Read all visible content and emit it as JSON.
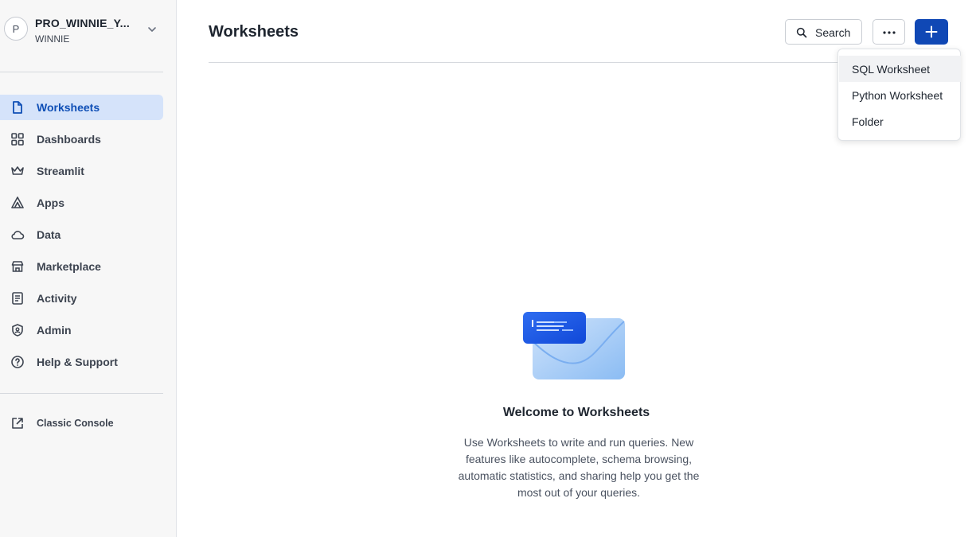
{
  "account": {
    "avatar_letter": "P",
    "name": "PRO_WINNIE_Y...",
    "user": "WINNIE"
  },
  "sidebar": {
    "items": [
      {
        "label": "Worksheets",
        "icon": "file-icon",
        "active": true
      },
      {
        "label": "Dashboards",
        "icon": "grid-icon",
        "active": false
      },
      {
        "label": "Streamlit",
        "icon": "crown-icon",
        "active": false
      },
      {
        "label": "Apps",
        "icon": "apps-icon",
        "active": false
      },
      {
        "label": "Data",
        "icon": "cloud-icon",
        "active": false
      },
      {
        "label": "Marketplace",
        "icon": "store-icon",
        "active": false
      },
      {
        "label": "Activity",
        "icon": "activity-icon",
        "active": false
      },
      {
        "label": "Admin",
        "icon": "shield-icon",
        "active": false
      },
      {
        "label": "Help & Support",
        "icon": "help-icon",
        "active": false
      }
    ],
    "classic_console": "Classic Console"
  },
  "header": {
    "title": "Worksheets",
    "search_label": "Search"
  },
  "create_menu": {
    "items": [
      "SQL Worksheet",
      "Python Worksheet",
      "Folder"
    ]
  },
  "empty_state": {
    "title": "Welcome to Worksheets",
    "body": "Use Worksheets to write and run queries. New features like autocomplete, schema browsing, automatic statistics, and sharing help you get the most out of your queries."
  },
  "colors": {
    "accent": "#1048b5",
    "active_bg": "#d5e3fa",
    "active_text": "#0f4fb6",
    "sidebar_bg": "#f7f7f7"
  }
}
